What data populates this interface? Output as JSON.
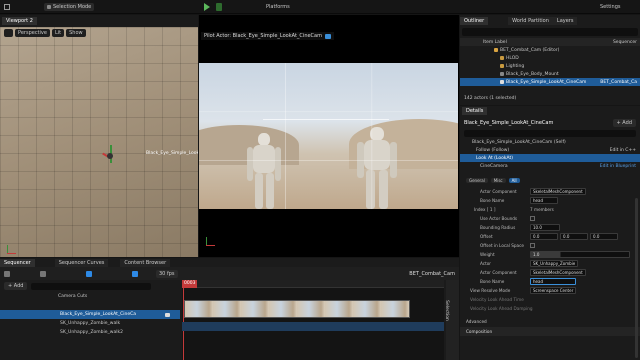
{
  "toolbar": {
    "selection_mode": "Selection Mode",
    "platforms": "Platforms",
    "settings": "Settings"
  },
  "viewport": {
    "tab": "Viewport 2",
    "perspective": "Perspective",
    "lit": "Lit",
    "show": "Show",
    "actor_label": "Black_Eye_Simple_LookAt_CineCam"
  },
  "pilot": {
    "label": "Pilot Actor: Black_Eye_Simple_LookAt_CineCam"
  },
  "outliner": {
    "tabs": [
      "Outliner",
      "World Partition",
      "Layers"
    ],
    "header_item_label": "Item Label",
    "header_type": "Sequencer",
    "items": [
      "BET_Combat_Cam (Editor)",
      "HLOD",
      "Lighting",
      "Black_Eye_Body_Mount",
      "Black_Eye_Simple_LookAt_CineCam"
    ],
    "selected_type": "BET_Combat_Ca",
    "count": "142 actors (1 selected)"
  },
  "details": {
    "tab": "Details",
    "actor_name": "Black_Eye_Simple_LookAt_CineCam",
    "add": "+ Add",
    "components": [
      "Black_Eye_Simple_LookAt_CineCam (Self)",
      "Follow (Follow)",
      "Look At (LookAt)",
      "CineCamera"
    ],
    "edit_cpp": "Edit in C++",
    "edit_bp": "Edit in Blueprint",
    "filter_tabs": [
      "General",
      "Misc",
      "All"
    ],
    "props": [
      {
        "label": "Actor Component",
        "value": "SkeletalMeshComponent"
      },
      {
        "label": "Bone Name",
        "value": "head"
      },
      {
        "label": "Index [ 1 ]",
        "value": "7 members"
      },
      {
        "label": "Use Actor Bounds",
        "value": ""
      },
      {
        "label": "Bounding Radius",
        "value": "10.0"
      },
      {
        "label": "Offset",
        "value": "0.0"
      },
      {
        "label": "Offset in Local Space",
        "value": ""
      },
      {
        "label": "Weight",
        "value": "1.0"
      },
      {
        "label": "Actor",
        "value": "SK_Unhappy_Zombie"
      },
      {
        "label": "Actor Component",
        "value": "SkeletalMeshComponent"
      },
      {
        "label": "Bone Name",
        "value": "head"
      },
      {
        "label": "View Resolve Mode",
        "value": "Screenspace Center"
      },
      {
        "label": "Velocity Look Ahead Time",
        "value": ""
      },
      {
        "label": "Velocity Look Ahead Damping",
        "value": ""
      }
    ],
    "offset_y": "0.0",
    "offset_z": "0.0",
    "advanced": "Advanced",
    "composition": "Composition"
  },
  "sequencer": {
    "tabs": [
      "Sequencer",
      "Sequencer Curves",
      "Content Browser"
    ],
    "fps": "30 fps",
    "add": "+ Add",
    "sequence_name": "BET_Combat_Cam",
    "frame": "0003",
    "tracks": [
      "Camera Cuts",
      "Black_Eye_Simple_LookAt_CineCa",
      "SK_Unhappy_Zombie_walk",
      "SK_Unhappy_Zombie_walk2"
    ],
    "selection_label": "Selection"
  }
}
